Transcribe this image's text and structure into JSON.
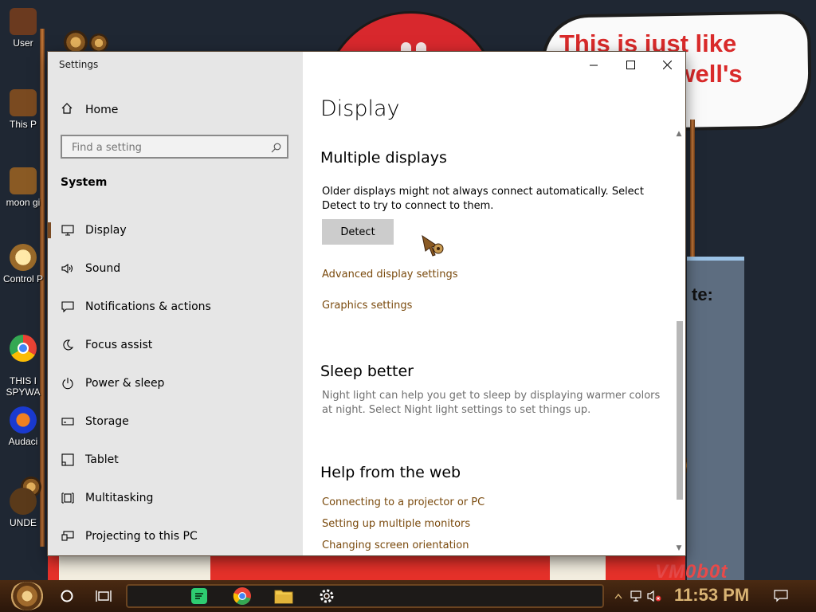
{
  "desktop": {
    "speech_text": "This is just like\n                 well's",
    "partial_panel_text": "te:",
    "corner_text": "VM0b0t",
    "icons": [
      {
        "label": "User"
      },
      {
        "label": "This P"
      },
      {
        "label": "moon gi"
      },
      {
        "label": "Control P"
      },
      {
        "label": "THIS I\nSPYWA"
      },
      {
        "label": "Audaci"
      },
      {
        "label": "UNDE"
      }
    ]
  },
  "window": {
    "app_title": "Settings",
    "controls": {
      "minimize": "minimize-icon",
      "maximize": "maximize-icon",
      "close": "close-icon"
    }
  },
  "sidebar": {
    "home_label": "Home",
    "search_placeholder": "Find a setting",
    "section": "System",
    "items": [
      {
        "label": "Display",
        "icon": "monitor-icon",
        "active": true
      },
      {
        "label": "Sound",
        "icon": "speaker-icon"
      },
      {
        "label": "Notifications & actions",
        "icon": "notification-icon"
      },
      {
        "label": "Focus assist",
        "icon": "moon-icon"
      },
      {
        "label": "Power & sleep",
        "icon": "power-icon"
      },
      {
        "label": "Storage",
        "icon": "storage-icon"
      },
      {
        "label": "Tablet",
        "icon": "tablet-icon"
      },
      {
        "label": "Multitasking",
        "icon": "multitasking-icon"
      },
      {
        "label": "Projecting to this PC",
        "icon": "projector-icon"
      }
    ]
  },
  "main": {
    "title": "Display",
    "multiple_displays": {
      "heading": "Multiple displays",
      "description": "Older displays might not always connect automatically. Select Detect to try to connect to them.",
      "detect_label": "Detect",
      "links": [
        "Advanced display settings",
        "Graphics settings"
      ]
    },
    "sleep_better": {
      "heading": "Sleep better",
      "description": "Night light can help you get to sleep by displaying warmer colors at night. Select Night light settings to set things up."
    },
    "help": {
      "heading": "Help from the web",
      "links": [
        "Connecting to a projector or PC",
        "Setting up multiple monitors",
        "Changing screen orientation"
      ]
    }
  },
  "taskbar": {
    "time": "11:53 PM",
    "pinned": [
      "spotify-icon",
      "chrome-icon",
      "file-explorer-icon",
      "settings-gear-icon"
    ]
  },
  "colors": {
    "accent_link": "#7a4a0d",
    "sidebar_bg": "#e6e6e6",
    "button_bg": "#cccccc",
    "taskbar": "#3a1f0d",
    "clock": "#d9b474"
  }
}
